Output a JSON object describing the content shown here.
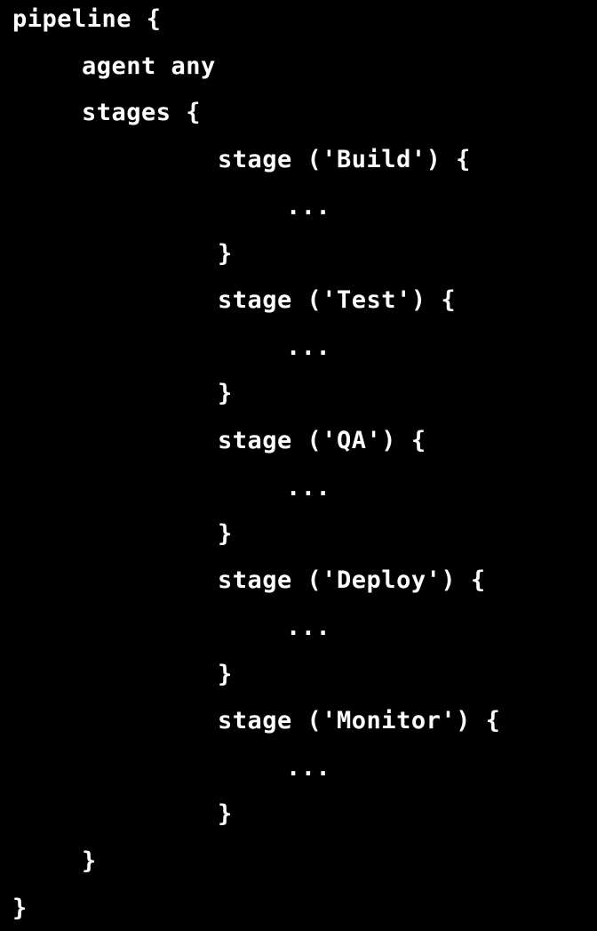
{
  "code": {
    "lines": [
      "pipeline {",
      "agent any",
      "stages {",
      "stage ('Build') {",
      "...",
      "}",
      "stage ('Test') {",
      "...",
      "}",
      "stage ('QA') {",
      "...",
      "}",
      "stage ('Deploy') {",
      "...",
      "}",
      "stage ('Monitor') {",
      "...",
      "}",
      "}",
      "}"
    ]
  },
  "colors": {
    "background": "#000000",
    "text": "#ffffff"
  }
}
